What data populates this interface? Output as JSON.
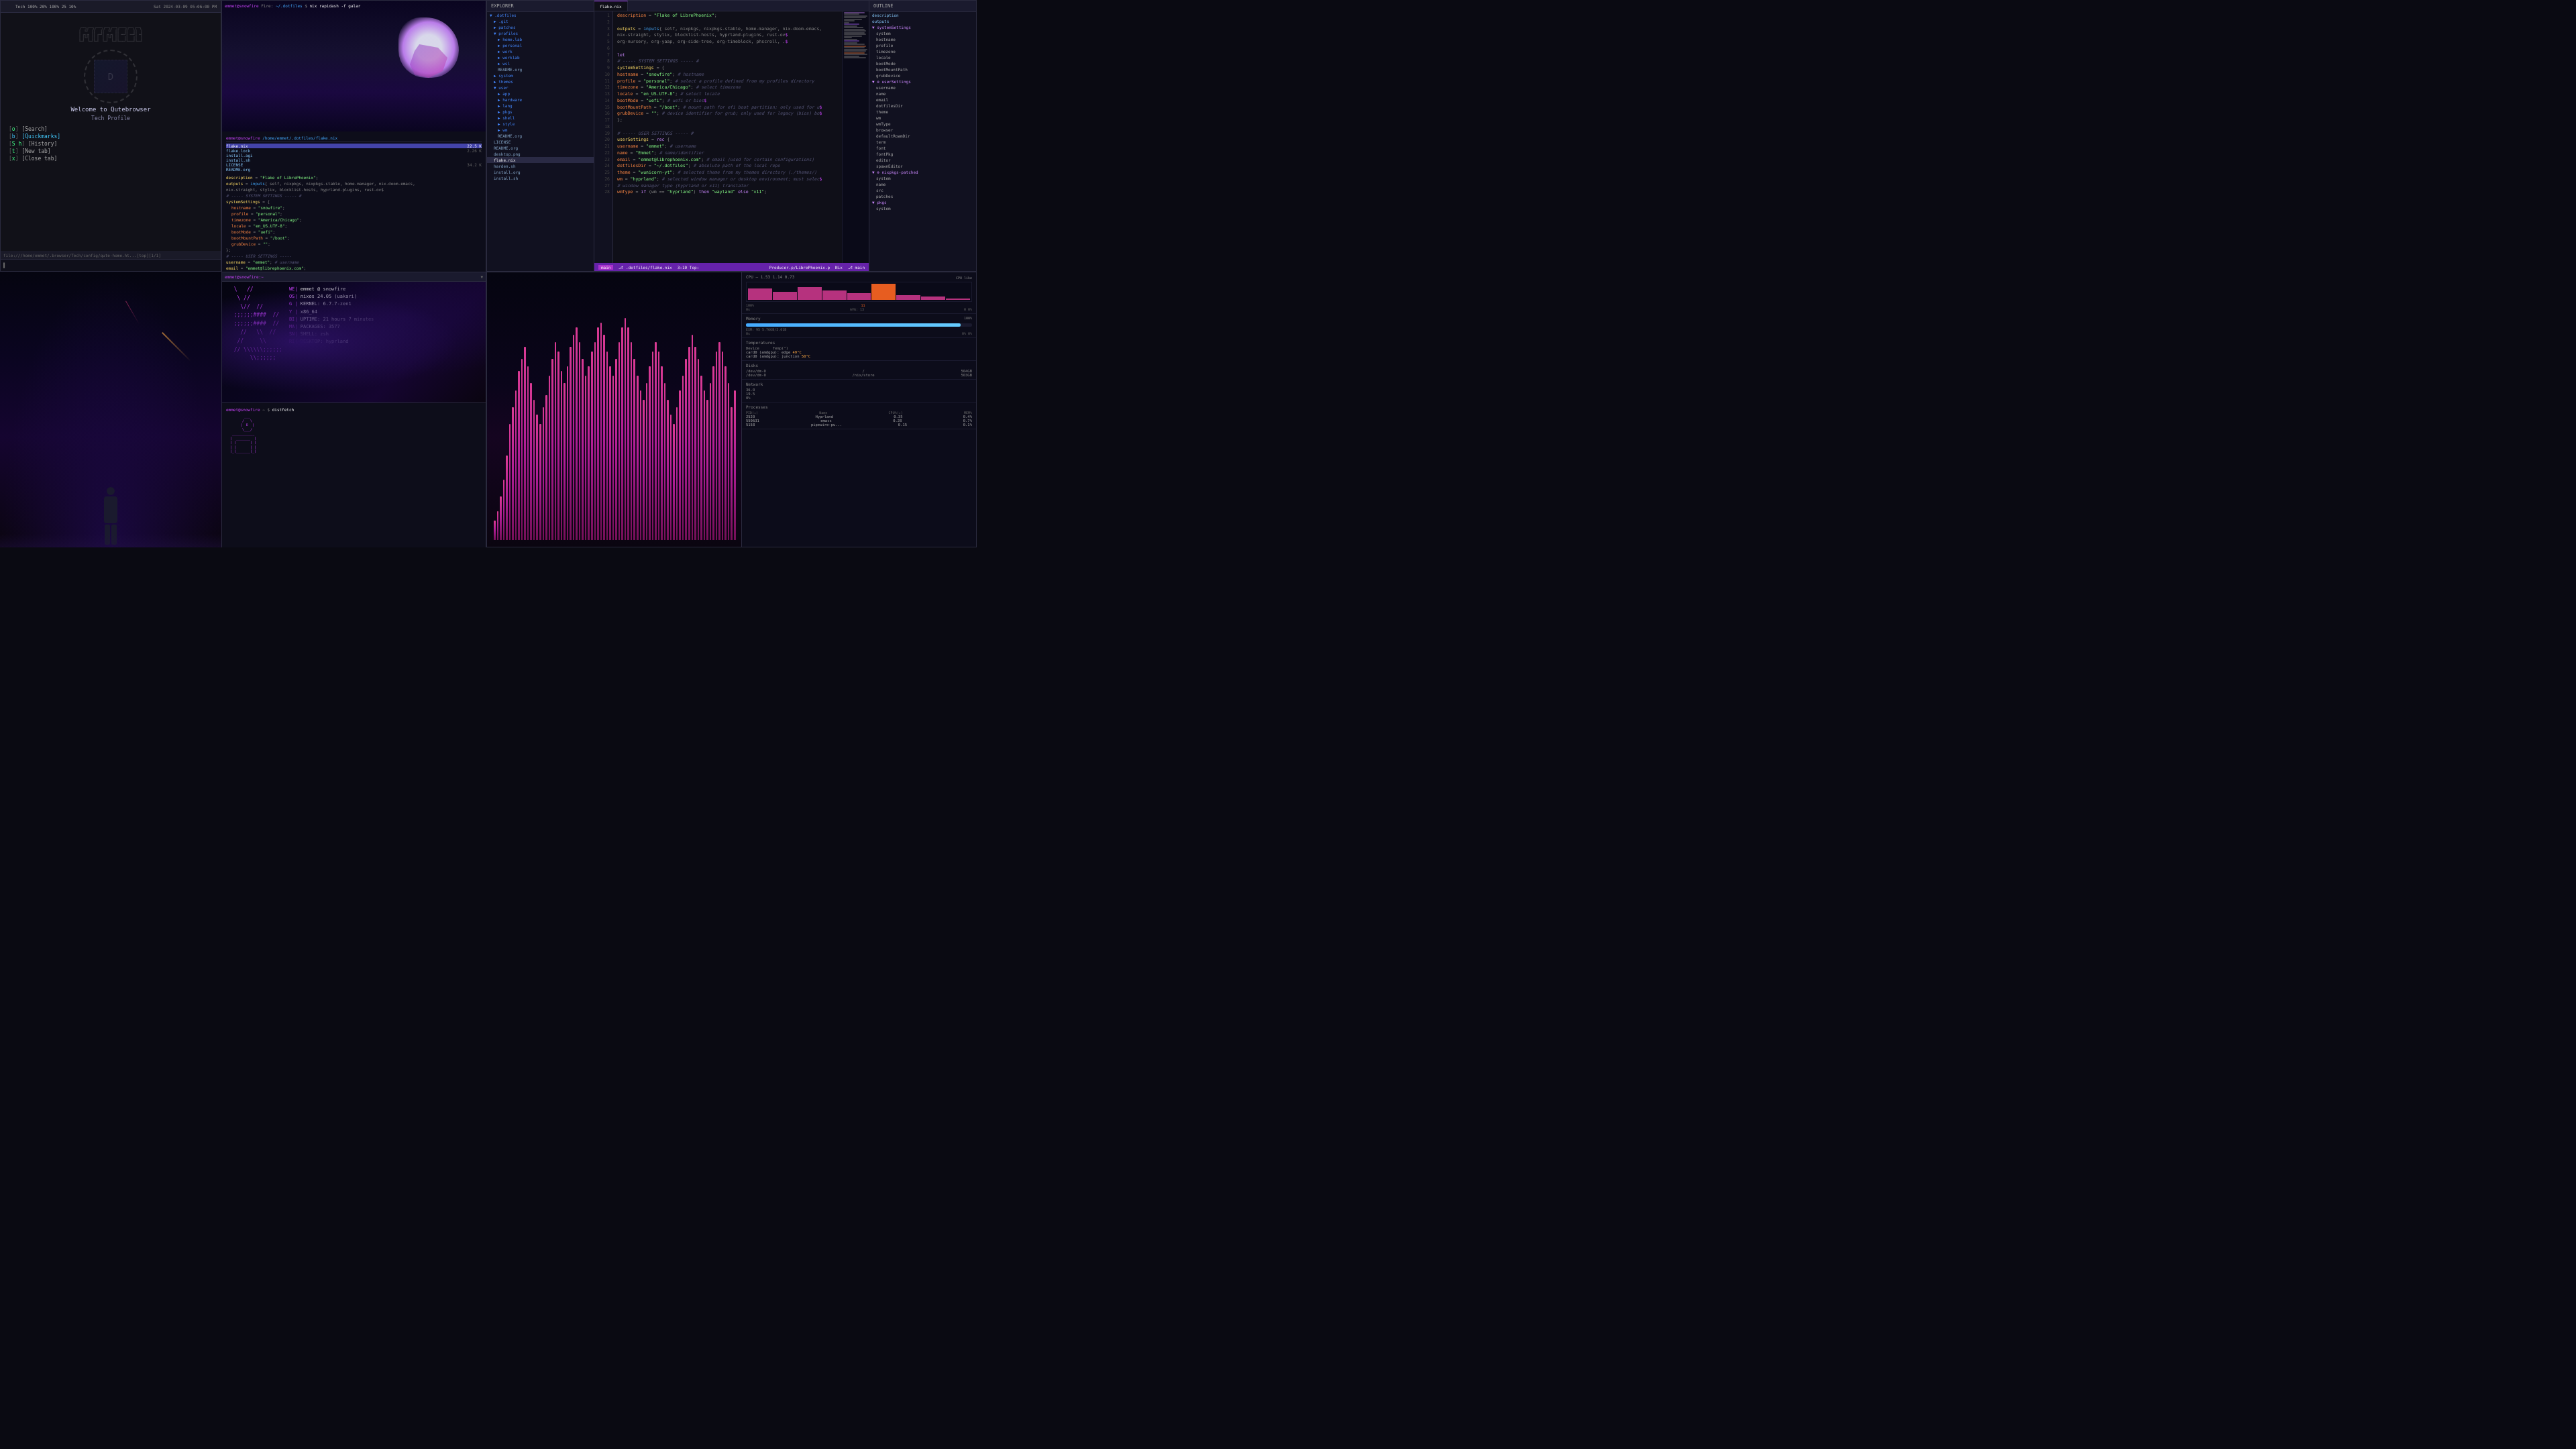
{
  "system": {
    "topbar_left": "Tech 100%  20%  100%  25  10%",
    "time": "Sat 2024-03-09 05:06:00 PM",
    "battery": "100%",
    "cpu": "20%",
    "mem": "100%",
    "tasks": "25",
    "net": "10%"
  },
  "browser": {
    "title": "Qutebrowser",
    "heading": "Welcome to Qutebrowser",
    "subheading": "Tech Profile",
    "links": [
      {
        "key": "o",
        "label": "Search"
      },
      {
        "key": "b",
        "label": "Quickmarks"
      },
      {
        "key": "S h",
        "label": "History"
      },
      {
        "key": "t",
        "label": "New tab"
      },
      {
        "key": "x",
        "label": "Close tab"
      }
    ],
    "status_url": "file:///home/emmet/.browser/Tech/config/qute-home.ht...[top][1/1]",
    "cmd_bar": ""
  },
  "fileterm": {
    "title": "emmet@snowfire:~",
    "prompt": "emmet@snowfire",
    "path": "/home/emmet/.dotfiles",
    "cmd": "nix rapidash -f galar",
    "files": [
      {
        "name": "flake.nix",
        "size": "22.5 K",
        "selected": true
      },
      {
        "name": "flake.lock",
        "size": "2.26 K"
      },
      {
        "name": "install.agi",
        "size": ""
      },
      {
        "name": "install.sh",
        "size": ""
      },
      {
        "name": "LICENSE",
        "size": "34.2 K"
      },
      {
        "name": "README.org",
        "size": ""
      }
    ],
    "terminal_lines": [
      "$ emmet@snowfire /home/emmet/.dotfiles/flake.nix",
      "description = \"Flake of LibrePhoenix\";",
      "outputs = inputs{ self, nixpkgs, nixpkgs-stable, home-manager,",
      "  nix-doom-emacs, nix-straight, stylix, blocklist-hosts,",
      "  hyprland-plugins, rust-ov$ }",
      "let",
      "  # ----- SYSTEM SETTINGS -----",
      "  systemSettings = {",
      "    hostname = \"snowfire\"; # system arch",
      "    profile = \"personal\"; # select a profile",
      "    timezone = \"America/Chicago\"; # select timezone",
      "    locale = \"en_US.UTF-8\";",
      "    bootMode = \"uefi\"; # uefi or bios",
      "    bootMountPath = \"/boot\"; # mount path",
      "    grubDevice = \"\";",
      "  };",
      "  # ----- USER SETTINGS -----",
      "  username = \"emmet\"; # username",
      "  name = \"Emmet\"; # name/identifier",
      "  email = \"emmet@librephoenix.com\";",
      "  dotfilesDir = \"~/.dotfiles\";",
      "  theme = \"wunicorn-yt\"; # selected theme",
      "  wm = \"hyprland\";",
      "  wmType = if (wm == \"hyprland\") then \"wayland\" else \"x11\";"
    ]
  },
  "editor": {
    "title": ".dotfiles",
    "tab": "flake.nix",
    "statusbar": ".dotfiles/flake.nix  3:10  Top:  Producer.p/LibrePhoenix.p  Nix  main",
    "sidebar_title": "EXPLORER",
    "tree": [
      {
        "label": ".dotfiles",
        "type": "folder",
        "indent": 0
      },
      {
        "label": ".git",
        "type": "folder",
        "indent": 1
      },
      {
        "label": "patches",
        "type": "folder",
        "indent": 1
      },
      {
        "label": "profiles",
        "type": "folder",
        "indent": 1,
        "open": true
      },
      {
        "label": "home.lab",
        "type": "folder",
        "indent": 2
      },
      {
        "label": "personal",
        "type": "folder",
        "indent": 2
      },
      {
        "label": "work",
        "type": "folder",
        "indent": 2
      },
      {
        "label": "worklab",
        "type": "folder",
        "indent": 2
      },
      {
        "label": "wsl",
        "type": "folder",
        "indent": 2
      },
      {
        "label": "README.org",
        "type": "file",
        "indent": 2
      },
      {
        "label": "system",
        "type": "folder",
        "indent": 1
      },
      {
        "label": "themes",
        "type": "folder",
        "indent": 1
      },
      {
        "label": "user",
        "type": "folder",
        "indent": 1,
        "open": true
      },
      {
        "label": "app",
        "type": "folder",
        "indent": 2
      },
      {
        "label": "hardware",
        "type": "folder",
        "indent": 2
      },
      {
        "label": "lang",
        "type": "folder",
        "indent": 2
      },
      {
        "label": "pkgs",
        "type": "folder",
        "indent": 2
      },
      {
        "label": "shell",
        "type": "folder",
        "indent": 2
      },
      {
        "label": "style",
        "type": "folder",
        "indent": 2
      },
      {
        "label": "wm",
        "type": "folder",
        "indent": 2
      },
      {
        "label": "README.org",
        "type": "file",
        "indent": 2
      },
      {
        "label": "LICENSE",
        "type": "file",
        "indent": 1
      },
      {
        "label": "README.org",
        "type": "file",
        "indent": 1
      },
      {
        "label": "desktop.png",
        "type": "file",
        "indent": 1
      },
      {
        "label": "flake.nix",
        "type": "file",
        "indent": 1,
        "selected": true
      },
      {
        "label": "harden.sh",
        "type": "file",
        "indent": 1
      },
      {
        "label": "install.org",
        "type": "file",
        "indent": 1
      },
      {
        "label": "install.sh",
        "type": "file",
        "indent": 1
      }
    ],
    "right_tree": [
      {
        "label": "description",
        "indent": 0
      },
      {
        "label": "outputs",
        "indent": 0
      },
      {
        "label": "systemSettings",
        "indent": 1,
        "open": true
      },
      {
        "label": "system",
        "indent": 2
      },
      {
        "label": "hostname",
        "indent": 2
      },
      {
        "label": "profile",
        "indent": 2
      },
      {
        "label": "timezone",
        "indent": 2
      },
      {
        "label": "locale",
        "indent": 2
      },
      {
        "label": "bootMode",
        "indent": 2
      },
      {
        "label": "bootMountPath",
        "indent": 2
      },
      {
        "label": "grubDevice",
        "indent": 2
      },
      {
        "label": "userSettings",
        "indent": 1,
        "open": true
      },
      {
        "label": "username",
        "indent": 2
      },
      {
        "label": "name",
        "indent": 2
      },
      {
        "label": "email",
        "indent": 2
      },
      {
        "label": "dotfilesDir",
        "indent": 2
      },
      {
        "label": "theme",
        "indent": 2
      },
      {
        "label": "wm",
        "indent": 2
      },
      {
        "label": "wmType",
        "indent": 2
      },
      {
        "label": "browser",
        "indent": 2
      },
      {
        "label": "defaultRoamDir",
        "indent": 2
      },
      {
        "label": "term",
        "indent": 2
      },
      {
        "label": "font",
        "indent": 2
      },
      {
        "label": "fontPkg",
        "indent": 2
      },
      {
        "label": "editor",
        "indent": 2
      },
      {
        "label": "spawnEditor",
        "indent": 2
      },
      {
        "label": "nixpkgs-patched",
        "indent": 1,
        "open": true
      },
      {
        "label": "system",
        "indent": 2
      },
      {
        "label": "name",
        "indent": 2
      },
      {
        "label": "src",
        "indent": 2
      },
      {
        "label": "patches",
        "indent": 2
      },
      {
        "label": "pkgs",
        "indent": 1,
        "open": true
      },
      {
        "label": "system",
        "indent": 2
      }
    ],
    "code_lines": [
      "description = \"Flake of LibrePhoenix\";",
      "",
      "outputs = inputs{ self, nixpkgs, nixpkgs-stable, home-manager, nix-doom-emacs,",
      "  nix-straight, stylix, blocklist-hosts, hyprland-plugins, rust-ov$",
      "  org-nursery, org-yaap, org-side-tree, org-timeblock, phscroll, .$",
      "",
      "let",
      "  # ----- SYSTEM SETTINGS ----- #",
      "  systemSettings = {",
      "    hostname = \"snowfire\"; # hostname",
      "    profile = \"personal\"; # select a profile defined from my profiles directory",
      "    timezone = \"America/Chicago\"; # select timezone",
      "    locale = \"en_US.UTF-8\"; # select locale",
      "    bootMode = \"uefi\"; # uefi or bios$",
      "    bootMountPath = \"/boot\"; # mount path for efi boot partition; only used for u$",
      "    grubDevice = \"\"; # device identifier for grub; only used for legacy (bios) bo$",
      "  };",
      "",
      "  # ----- USER SETTINGS ----- #",
      "  userSettings = rec {",
      "    username = \"emmet\"; # username",
      "    name = \"Emmet\"; # name/identifier",
      "    email = \"emmet@librephoenix.com\"; # email (used for certain configurations)",
      "    dotfilesDir = \"~/.dotfiles\"; # absolute path of the local repo",
      "    theme = \"wunicorn-yt\"; # selected theme from my themes directory (./themes/)",
      "    wm = \"hyprland\"; # selected window manager or desktop environment; must selec$",
      "    # window manager type (hyprland or x11) translator",
      "    wmType = if (wm == \"hyprland\") then \"wayland\" else \"x11\";"
    ],
    "line_count": 28
  },
  "fetch": {
    "title": "emmet@snowfire:~",
    "logo_lines": [
      "  \\   //         ",
      "   \\ //          ",
      "    \\//   //     ",
      "  ;;;;;;####  // ",
      "  ;;;;;;####  // ",
      "    //   \\\\   // ",
      "   //     \\\\     ",
      "  //  \\\\\\\\;;;;;; ",
      "        \\\\;;;;;; "
    ],
    "info": [
      {
        "label": "WE",
        "value": "emmet @ snowfire"
      },
      {
        "label": "OS",
        "value": "nixos 24.05 (uakari)"
      },
      {
        "label": "KE",
        "value": "6.7.7-zen1"
      },
      {
        "label": "Y",
        "value": "x86_64"
      },
      {
        "label": "BI",
        "value": "21 hours 7 minutes"
      },
      {
        "label": "MA",
        "value": "PACKAGES: 3577"
      },
      {
        "label": "SN",
        "value": "SHELL: zsh"
      },
      {
        "label": "RI",
        "value": "DESKTOP: hyprland"
      }
    ],
    "cmd": "distfetch"
  },
  "sysmon": {
    "cpu_label": "CPU",
    "cpu_value": "1.53 1.14 0.73",
    "cpu_percent": 11,
    "cpu_avg": 13,
    "cpu_min": 0,
    "cpu_max": 100,
    "mem_label": "Memory",
    "mem_percent": 95,
    "mem_used": "5.76GB",
    "mem_total": "2.01B",
    "mem_bar": 95,
    "temps": [
      {
        "device": "card0 (amdgpu):",
        "type": "edge",
        "value": "49°C"
      },
      {
        "device": "card0 (amdgpu):",
        "type": "junction",
        "value": "58°C"
      }
    ],
    "disks": [
      {
        "path": "/dev/dm-0",
        "mount": "/",
        "size": "504GB"
      },
      {
        "path": "/dev/dm-0",
        "mount": "/nix/store",
        "size": "503GB"
      }
    ],
    "network": [
      {
        "label": "36.0",
        "type": ""
      },
      {
        "label": "19.5",
        "type": ""
      },
      {
        "label": "0%",
        "type": ""
      }
    ],
    "processes": [
      {
        "name": "Hyprland",
        "pid": 2520,
        "cpu": "0.35",
        "mem": "0.4%"
      },
      {
        "name": "emacs",
        "pid": 550631,
        "cpu": "0.28",
        "mem": "0.7%"
      },
      {
        "name": "pipewire-pu...",
        "pid": 5158,
        "cpu": "0.15",
        "mem": "0.1%"
      }
    ],
    "bars": [
      8,
      12,
      18,
      25,
      35,
      48,
      55,
      62,
      70,
      75,
      80,
      72,
      65,
      58,
      52,
      48,
      55,
      60,
      68,
      75,
      82,
      78,
      70,
      65,
      72,
      80,
      85,
      88,
      82,
      75,
      68,
      72,
      78,
      82,
      88,
      90,
      85,
      78,
      72,
      68,
      75,
      82,
      88,
      92,
      88,
      82,
      75,
      68,
      62,
      58,
      65,
      72,
      78,
      82,
      78,
      72,
      65,
      58,
      52,
      48,
      55,
      62,
      68,
      75,
      80,
      85,
      80,
      75,
      68,
      62,
      58,
      65,
      72,
      78,
      82,
      78,
      72,
      65,
      55,
      62
    ]
  }
}
